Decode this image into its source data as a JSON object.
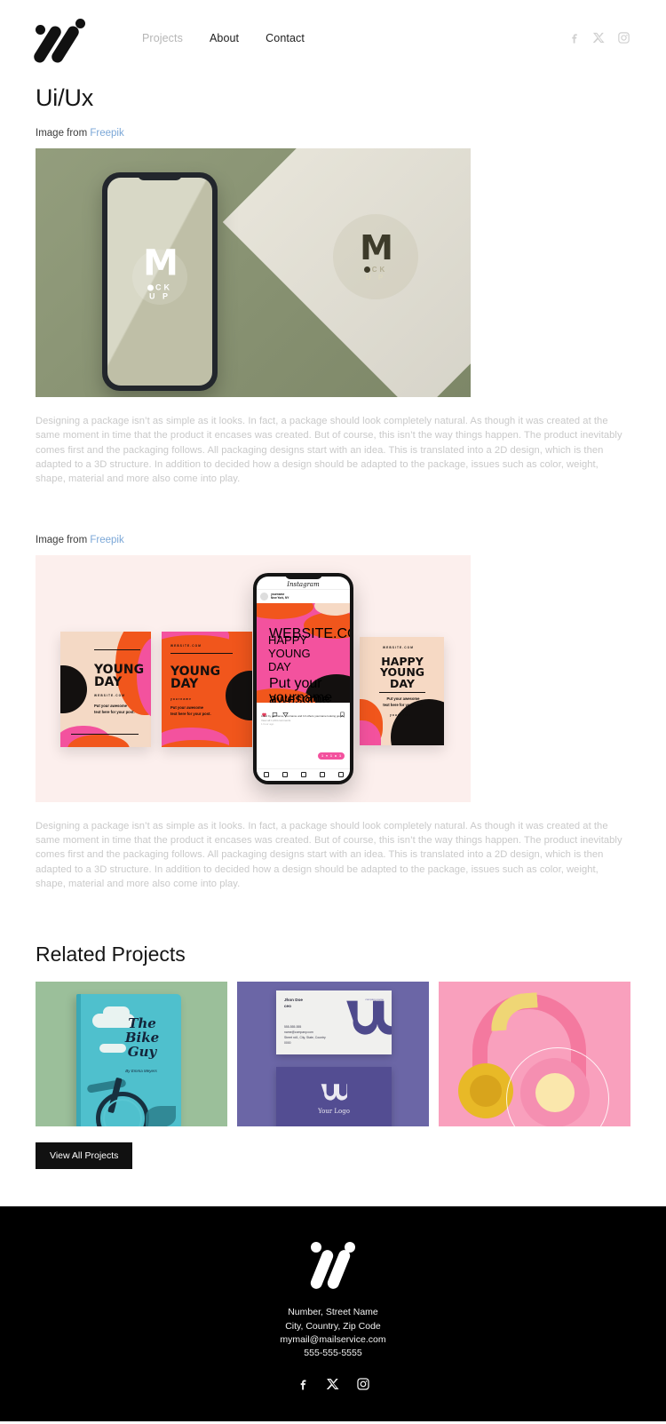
{
  "header": {
    "logo_name": "brand-logo",
    "nav": [
      {
        "label": "Projects",
        "state": "muted"
      },
      {
        "label": "About",
        "state": "normal"
      },
      {
        "label": "Contact",
        "state": "normal"
      }
    ],
    "social": [
      {
        "name": "facebook-icon",
        "label": "Facebook"
      },
      {
        "name": "x-twitter-icon",
        "label": "X"
      },
      {
        "name": "instagram-icon",
        "label": "Instagram"
      }
    ]
  },
  "main": {
    "title": "Ui/Ux",
    "credit_prefix": "Image from",
    "credit_link": "Freepik",
    "paragraph": "Designing a package isn’t as simple as it looks. In fact, a package should look completely natural. As though it was created at the same moment in time that the product it encases was created. But of course, this isn’t the way things happen. The product inevitably comes first and the packaging follows. All packaging designs start with an idea. This is translated into a 2D design, which is then adapted to a 3D structure. In addition to decided how a design should be adapted to the package, issues such as color, weight, shape, material and more also come into play.",
    "figure1": {
      "name": "phone-mockup-image",
      "mock_m": "M",
      "mock_line1": "CK",
      "mock_line2": "U P",
      "bg_color": "#8b9673",
      "panel_color": "#efece0"
    },
    "figure2": {
      "name": "social-media-mockup-image",
      "bg_color": "#fcefed",
      "cards": [
        {
          "title": "YOUNG\nDAY",
          "website": "WEBSITE.COM",
          "body": "Put your awesome\ntext here for your post."
        },
        {
          "title": "YOUNG\nDAY",
          "website": "WEBSITE.COM",
          "body": "Put your awesome\ntext here for your post."
        },
        {
          "title": "HAPPY\nYOUNG DAY",
          "website": "WEBSITE.COM",
          "body": "Put your awesome\ntext here for your post."
        }
      ],
      "phone": {
        "app_name": "Instagram",
        "post_title": "HAPPY\nYOUNG\nDAY",
        "website": "WEBSITE.COM",
        "body": "Put your awesome\ntext here for your post.",
        "username": "yourname",
        "location": "New York, NY",
        "caption": "Liked by yourname, yourname and 13 others\nyourname looking good!",
        "comments": "View all 1,234 comments",
        "time": "1 hour ago"
      }
    }
  },
  "related": {
    "title": "Related Projects",
    "items": [
      {
        "name": "project-thumb-book",
        "book_title": "The\nBike\nGuy",
        "book_author": "By Emma Meyers"
      },
      {
        "name": "project-thumb-branding",
        "card_name": "Jhon Doe\nceo",
        "card_contact": "555-555-555\nname@company.com\nStreet n#1, City, State, Country\n0000",
        "card_tag": "company-name",
        "logo_label": "Your Logo"
      },
      {
        "name": "project-thumb-headphones"
      }
    ],
    "button_label": "View All Projects"
  },
  "footer": {
    "logo_name": "brand-logo-footer",
    "address_line1": "Number, Street Name",
    "address_line2": "City, Country, Zip Code",
    "email": "mymail@mailservice.com",
    "phone": "555-555-5555",
    "social": [
      {
        "name": "facebook-icon",
        "label": "Facebook"
      },
      {
        "name": "x-twitter-icon",
        "label": "X"
      },
      {
        "name": "instagram-icon",
        "label": "Instagram"
      }
    ]
  }
}
